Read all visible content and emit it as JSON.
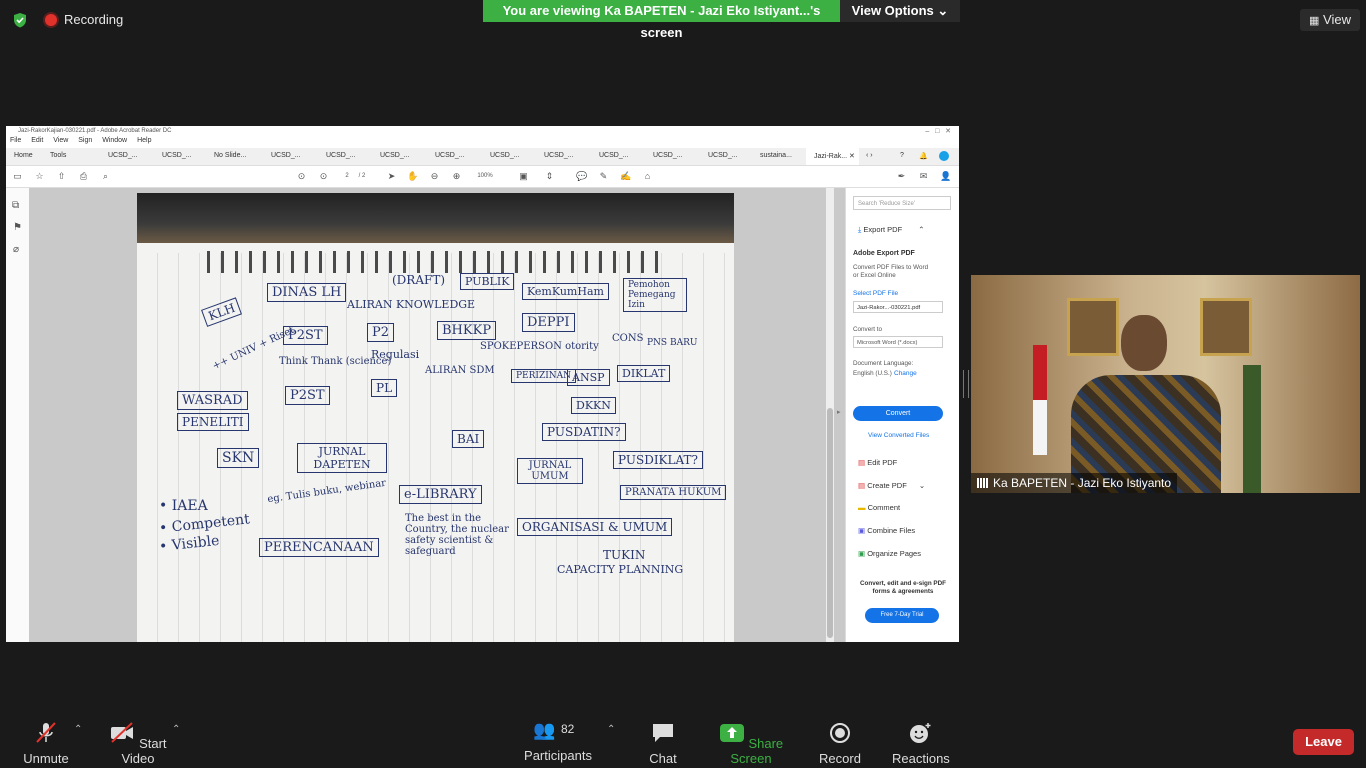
{
  "top_bar": {
    "recording_label": "Recording",
    "banner_text": "You are viewing Ka BAPETEN - Jazi Eko Istiyant...'s screen",
    "view_options_label": "View Options",
    "view_label": "View"
  },
  "shared_screen": {
    "title": "Jazi-RakorKajian-030221.pdf - Adobe Acrobat Reader DC",
    "menu": [
      "File",
      "Edit",
      "View",
      "Sign",
      "Window",
      "Help"
    ],
    "home_tab": "Home",
    "tools_tab": "Tools",
    "doc_tabs": [
      "UCSD_...",
      "UCSD_...",
      "No Slide...",
      "UCSD_...",
      "UCSD_...",
      "UCSD_...",
      "UCSD_...",
      "UCSD_...",
      "UCSD_...",
      "UCSD_...",
      "UCSD_...",
      "UCSD_...",
      "sustaina...",
      "Jazi-Rak..."
    ],
    "page_num": "2",
    "page_total": "/ 2",
    "zoom": "100%",
    "right_panel": {
      "search_placeholder": "Search 'Reduce Size'",
      "export_pdf": "Export PDF",
      "adobe_export_title": "Adobe Export PDF",
      "convert_desc_1": "Convert PDF Files to Word",
      "convert_desc_2": "or Excel Online",
      "select_pdf_label": "Select PDF File",
      "selected_file": "Jazi-Rakor...-030221.pdf",
      "convert_to_label": "Convert to",
      "convert_to_value": "Microsoft Word (*.docx)",
      "doc_language_label": "Document Language:",
      "doc_language_value": "English (U.S.)",
      "change_link": "Change",
      "convert_button": "Convert",
      "view_converted": "View Converted Files",
      "tools": [
        "Edit PDF",
        "Create PDF",
        "Comment",
        "Combine Files",
        "Organize Pages"
      ],
      "promo_1": "Convert, edit and e-sign PDF",
      "promo_2": "forms & agreements",
      "trial_button": "Free 7-Day Trial"
    },
    "sketch_labels": {
      "klh": "KLH",
      "dinas_lh": "DINAS LH",
      "draft": "(DRAFT)",
      "publik": "PUBLIK",
      "kemkumham": "KemKumHam",
      "pemohon": "Pemohon Pemegang Izin",
      "aliran_knowledge": "ALIRAN KNOWLEDGE",
      "p2st_top": "P2ST",
      "p2": "P2",
      "bhkkp": "BHKKP",
      "deppi": "DEPPI",
      "univ": "++ UNIV + Riset",
      "regulasi": "Regulasi",
      "spokeperson": "SPOKEPERSON otority",
      "cons": "CONS",
      "pns_baru": "PNS BARU",
      "think_thank": "Think Thank (science)",
      "aliran_sdm": "ALIRAN SDM",
      "perizinan": "PERIZINAN",
      "ansp": "ANSP",
      "diklat": "DIKLAT",
      "wasrad": "WASRAD",
      "p2st_mid": "P2ST",
      "pl": "PL",
      "peneliti": "PENELITI",
      "dkkn": "DKKN",
      "bai": "BAI",
      "pusdatin": "PUSDATIN?",
      "skn": "SKN",
      "jurnal_dapeten": "JURNAL DAPETEN",
      "jurnal_umum": "JURNAL UMUM",
      "pusdiklat": "PUSDIKLAT?",
      "iaea": "• IAEA",
      "tulis_buku": "eg. Tulis buku, webinar",
      "e_library": "e-LIBRARY",
      "pranata_hukum": "PRANATA HUKUM",
      "competent": "• Competent",
      "visible": "• Visible",
      "the_best": "The best in the Country, the nuclear safety scientist & safeguard",
      "organisasi_umum": "ORGANISASI & UMUM",
      "perencanaan": "PERENCANAAN",
      "tukin": "TUKIN",
      "capacity_planning": "CAPACITY PLANNING"
    }
  },
  "video": {
    "participant_name": "Ka BAPETEN - Jazi Eko Istiyanto"
  },
  "bottom_toolbar": {
    "unmute": "Unmute",
    "start_video": "Start Video",
    "participants": "Participants",
    "participants_count": "82",
    "chat": "Chat",
    "share_screen": "Share Screen",
    "record": "Record",
    "reactions": "Reactions",
    "leave": "Leave"
  },
  "colors": {
    "banner_green": "#3cb043",
    "leave_red": "#c42a2a",
    "acrobat_blue": "#1473e6",
    "ink_blue": "#27366e"
  }
}
